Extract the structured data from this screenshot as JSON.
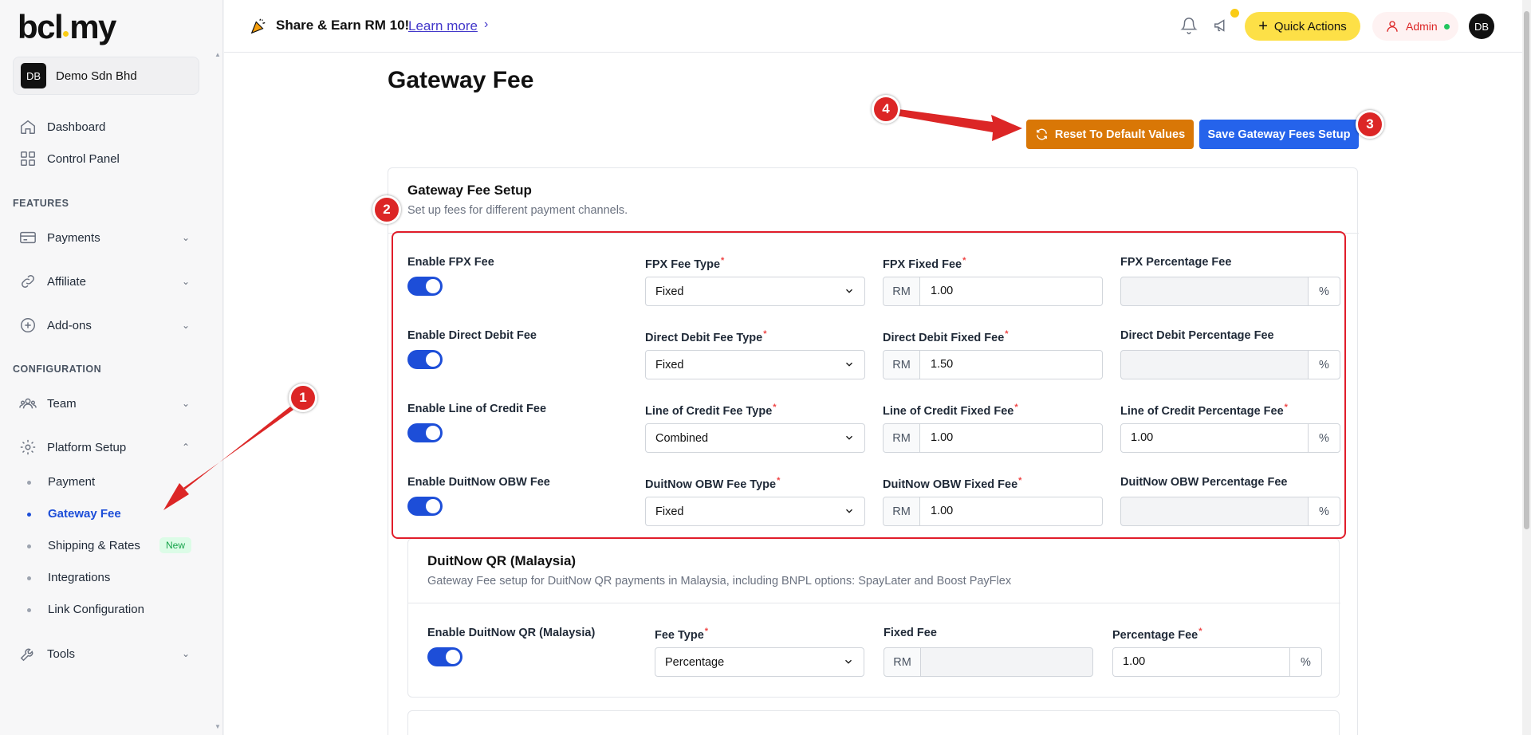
{
  "app": {
    "logo_text_a": "bcl",
    "logo_text_b": "my"
  },
  "sidebar": {
    "org_initials": "DB",
    "org_name": "Demo Sdn Bhd",
    "nav": [
      {
        "label": "Dashboard",
        "icon": "home-icon"
      },
      {
        "label": "Control Panel",
        "icon": "grid-icon"
      }
    ],
    "section_features": "FEATURES",
    "features": [
      {
        "label": "Payments",
        "icon": "card-icon"
      },
      {
        "label": "Affiliate",
        "icon": "link-icon"
      },
      {
        "label": "Add-ons",
        "icon": "plus-circle-icon"
      }
    ],
    "section_configuration": "CONFIGURATION",
    "configuration": [
      {
        "label": "Team",
        "icon": "team-icon"
      },
      {
        "label": "Platform Setup",
        "icon": "gear-icon"
      }
    ],
    "platform_sub": [
      {
        "label": "Payment"
      },
      {
        "label": "Gateway Fee",
        "active": true
      },
      {
        "label": "Shipping & Rates",
        "badge": "New"
      },
      {
        "label": "Integrations"
      },
      {
        "label": "Link Configuration"
      }
    ],
    "tools": {
      "label": "Tools",
      "icon": "tools-icon"
    }
  },
  "topbar": {
    "promo_text": "Share & Earn RM 10!",
    "learn_more": "Learn more",
    "quick_actions": "Quick Actions",
    "admin_label": "Admin",
    "user_initials": "DB"
  },
  "page": {
    "title": "Gateway Fee",
    "reset_button": "Reset To Default Values",
    "save_button": "Save Gateway Fees Setup"
  },
  "gateway_setup": {
    "title": "Gateway Fee Setup",
    "description": "Set up fees for different payment channels.",
    "currency_prefix": "RM",
    "percent_suffix": "%",
    "rows": [
      {
        "enable_label": "Enable FPX Fee",
        "enabled": true,
        "type_label": "FPX Fee Type",
        "type_value": "Fixed",
        "fixed_label": "FPX Fixed Fee",
        "fixed_value": "1.00",
        "pct_label": "FPX Percentage Fee",
        "pct_value": "",
        "pct_required": false
      },
      {
        "enable_label": "Enable Direct Debit Fee",
        "enabled": true,
        "type_label": "Direct Debit Fee Type",
        "type_value": "Fixed",
        "fixed_label": "Direct Debit Fixed Fee",
        "fixed_value": "1.50",
        "pct_label": "Direct Debit Percentage Fee",
        "pct_value": "",
        "pct_required": false
      },
      {
        "enable_label": "Enable Line of Credit Fee",
        "enabled": true,
        "type_label": "Line of Credit Fee Type",
        "type_value": "Combined",
        "fixed_label": "Line of Credit Fixed Fee",
        "fixed_value": "1.00",
        "pct_label": "Line of Credit Percentage Fee",
        "pct_value": "1.00",
        "pct_required": true
      },
      {
        "enable_label": "Enable DuitNow OBW Fee",
        "enabled": true,
        "type_label": "DuitNow OBW Fee Type",
        "type_value": "Fixed",
        "fixed_label": "DuitNow OBW Fixed Fee",
        "fixed_value": "1.00",
        "pct_label": "DuitNow OBW Percentage Fee",
        "pct_value": "",
        "pct_required": false
      }
    ]
  },
  "duitnow_qr": {
    "title": "DuitNow QR (Malaysia)",
    "description": "Gateway Fee setup for DuitNow QR payments in Malaysia, including BNPL options: SpayLater and Boost PayFlex",
    "enable_label": "Enable DuitNow QR (Malaysia)",
    "enabled": true,
    "type_label": "Fee Type",
    "type_value": "Percentage",
    "fixed_label": "Fixed Fee",
    "fixed_value": "",
    "pct_label": "Percentage Fee",
    "pct_value": "1.00"
  },
  "annotations": {
    "marker_1": "1",
    "marker_2": "2",
    "marker_3": "3",
    "marker_4": "4",
    "color": "#dc2626"
  },
  "colors": {
    "primary": "#2563eb",
    "reset": "#d97706",
    "toggle": "#1d4ed8",
    "accent_yellow": "#fde047"
  }
}
